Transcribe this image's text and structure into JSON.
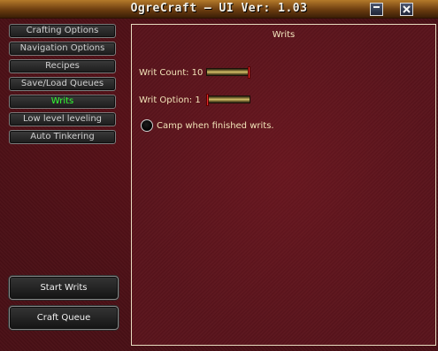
{
  "window": {
    "title": "OgreCraft — UI Ver: 1.03"
  },
  "nav": {
    "items": [
      {
        "label": "Crafting Options",
        "active": false
      },
      {
        "label": "Navigation Options",
        "active": false
      },
      {
        "label": "Recipes",
        "active": false
      },
      {
        "label": "Save/Load Queues",
        "active": false
      },
      {
        "label": "Writs",
        "active": true
      },
      {
        "label": "Low level leveling",
        "active": false
      },
      {
        "label": "Auto Tinkering",
        "active": false
      }
    ],
    "active_color": "#33ff33"
  },
  "actions": {
    "start_writs": "Start Writs",
    "craft_queue": "Craft Queue"
  },
  "writs": {
    "title": "Writs",
    "count_label": "Writ Count: 10",
    "count_level": 1.0,
    "option_label": "Writ Option: 1",
    "option_level": 0.0,
    "camp_label": "Camp when finished writs.",
    "camp_checked": false
  }
}
